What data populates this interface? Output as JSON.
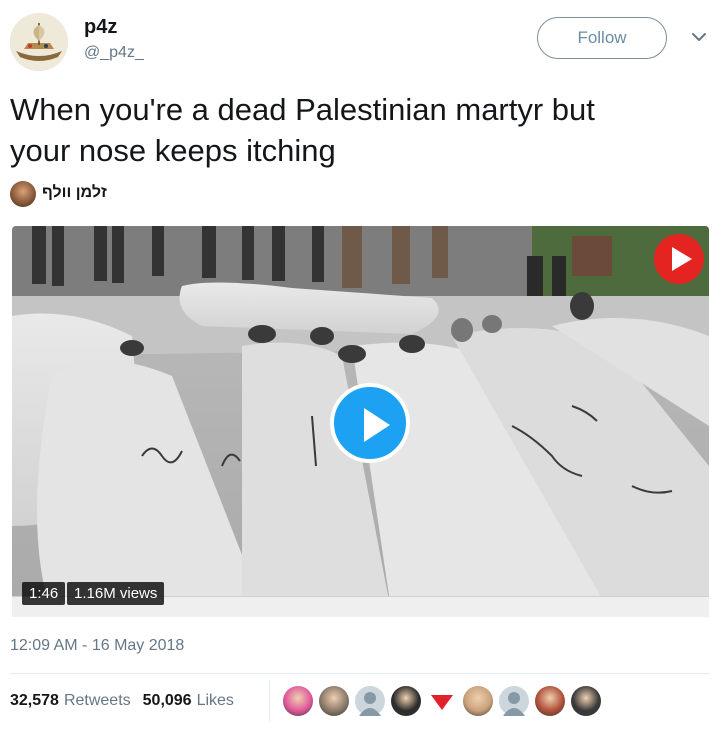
{
  "author": {
    "name": "p4z",
    "handle": "@_p4z_",
    "avatar_icon": "ship-painting-avatar"
  },
  "follow_button": {
    "label": "Follow"
  },
  "menu_icon": "chevron-down-icon",
  "tweet": {
    "text_line1": "When you're a dead Palestinian martyr but",
    "text_line2": "your nose keeps itching"
  },
  "mention": {
    "name": "זלמן וולף",
    "avatar_icon": "user-avatar"
  },
  "video": {
    "duration": "1:46",
    "views": "1.16M views",
    "play_icon": "play-icon",
    "channel_logo_icon": "channel-logo-icon"
  },
  "timestamp": "12:09 AM - 16 May 2018",
  "stats": {
    "retweets_count": "32,578",
    "retweets_label": "Retweets",
    "likes_count": "50,096",
    "likes_label": "Likes"
  },
  "likers": [
    {
      "name": "liker-avatar-1",
      "color": "#e05a9b"
    },
    {
      "name": "liker-avatar-2",
      "color": "#8a7a6a"
    },
    {
      "name": "liker-avatar-3",
      "color": "#aab8c2"
    },
    {
      "name": "liker-avatar-4",
      "color": "#2c2c2c"
    },
    {
      "name": "liker-avatar-5",
      "color": "#e0202a"
    },
    {
      "name": "liker-avatar-6",
      "color": "#c9a27a"
    },
    {
      "name": "liker-avatar-7",
      "color": "#aab8c2"
    },
    {
      "name": "liker-avatar-8",
      "color": "#b0503a"
    },
    {
      "name": "liker-avatar-9",
      "color": "#3a3a3a"
    }
  ],
  "colors": {
    "link_blue": "#1da1f2",
    "secondary_text": "#657786",
    "primary_text": "#14171a"
  }
}
